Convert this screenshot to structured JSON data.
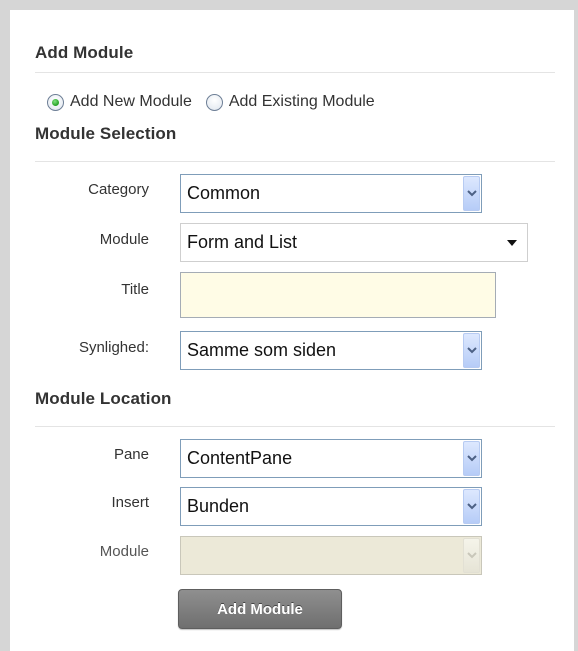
{
  "add_module": {
    "title": "Add Module",
    "options": [
      {
        "label": "Add New Module",
        "checked": true
      },
      {
        "label": "Add Existing Module",
        "checked": false
      }
    ]
  },
  "module_selection": {
    "title": "Module Selection",
    "category_label": "Category",
    "category_value": "Common",
    "module_label": "Module",
    "module_value": "Form and List",
    "title_label": "Title",
    "title_value": "",
    "visibility_label": "Synlighed:",
    "visibility_value": "Samme som siden"
  },
  "module_location": {
    "title": "Module Location",
    "pane_label": "Pane",
    "pane_value": "ContentPane",
    "insert_label": "Insert",
    "insert_value": "Bunden",
    "module_label": "Module",
    "module_value": ""
  },
  "actions": {
    "add_module_label": "Add Module"
  },
  "colors": {
    "frame": "#d6d6d6",
    "input_border": "#7f9db9",
    "title_bg": "#fffce6",
    "button_bg": "#7f7f7f"
  }
}
